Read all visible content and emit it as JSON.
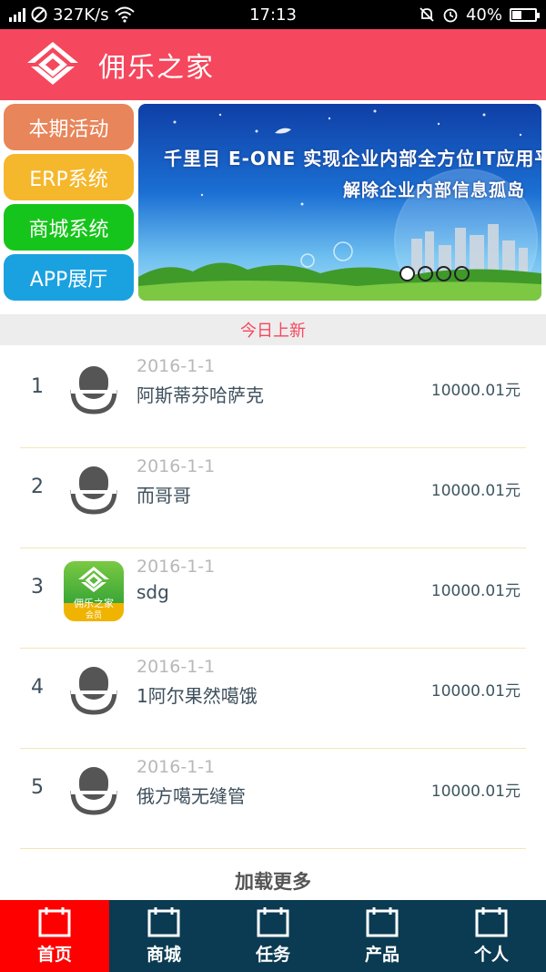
{
  "status_bar": {
    "signal": "2G",
    "speed": "327K/s",
    "time": "17:13",
    "battery": "40%",
    "battery_level": 0.4
  },
  "header": {
    "title": "佣乐之家",
    "accent": "#f5475d"
  },
  "menu": [
    {
      "label": "本期活动",
      "color": "#e8855a"
    },
    {
      "label": "ERP系统",
      "color": "#f5b72b"
    },
    {
      "label": "商城系统",
      "color": "#16c51b"
    },
    {
      "label": "APP展厅",
      "color": "#1aa1e0"
    }
  ],
  "banner": {
    "line1": "千里目 E-ONE 实现企业内部全方位IT应用平台",
    "line2": "解除企业内部信息孤岛",
    "dot_count": 4,
    "active_dot": 0
  },
  "section": {
    "title": "今日上新"
  },
  "list": [
    {
      "num": "1",
      "date": "2016-1-1",
      "name": "阿斯蒂芬哈萨克",
      "price": "10000.01元",
      "icon": "mic-icon"
    },
    {
      "num": "2",
      "date": "2016-1-1",
      "name": "而哥哥",
      "price": "10000.01元",
      "icon": "mic-icon"
    },
    {
      "num": "3",
      "date": "2016-1-1",
      "name": "sdg",
      "price": "10000.01元",
      "icon": "app-logo-icon",
      "badge_text": "佣乐之家",
      "badge_sub": "会员"
    },
    {
      "num": "4",
      "date": "2016-1-1",
      "name": "1阿尔果然噶饿",
      "price": "10000.01元",
      "icon": "mic-icon"
    },
    {
      "num": "5",
      "date": "2016-1-1",
      "name": "俄方噶无缝管",
      "price": "10000.01元",
      "icon": "mic-icon"
    }
  ],
  "load_more": "加载更多",
  "bottom_nav": [
    {
      "label": "首页",
      "active": true
    },
    {
      "label": "商城",
      "active": false
    },
    {
      "label": "任务",
      "active": false
    },
    {
      "label": "产品",
      "active": false
    },
    {
      "label": "个人",
      "active": false
    }
  ]
}
